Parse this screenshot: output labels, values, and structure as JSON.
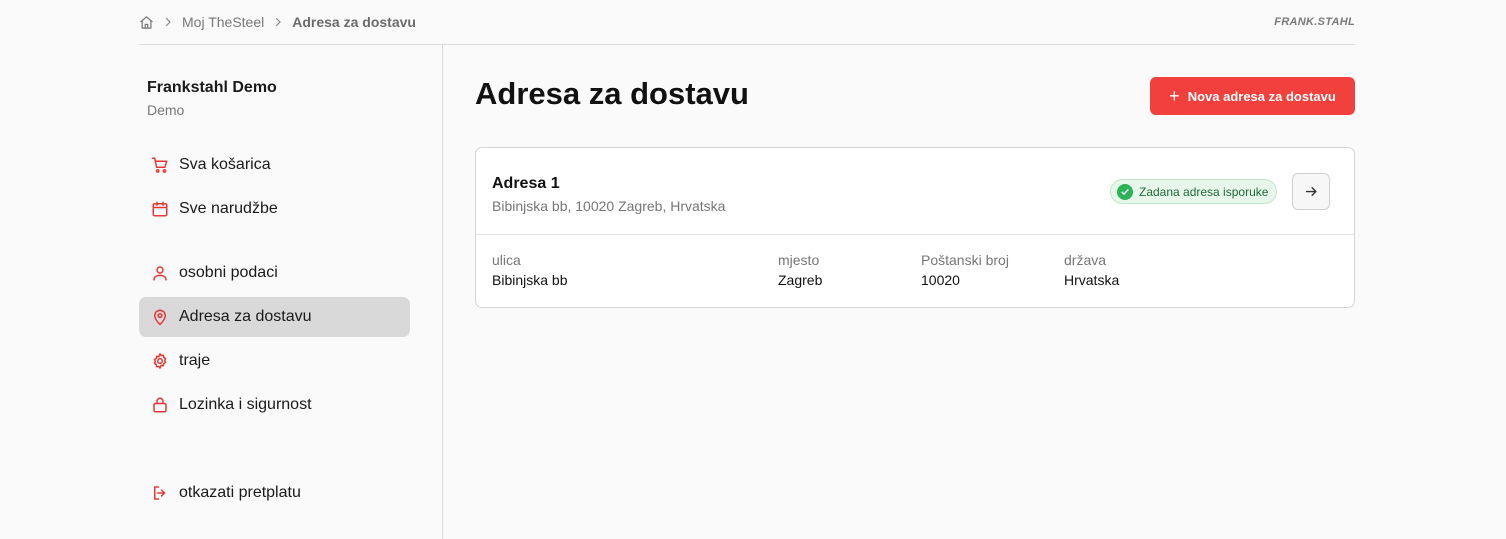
{
  "breadcrumb": {
    "home_icon": "home-icon",
    "items": [
      "Moj TheSteel",
      "Adresa za dostavu"
    ]
  },
  "logo": {
    "text": "FRANK.STAHL"
  },
  "account": {
    "name": "Frankstahl Demo",
    "subtitle": "Demo"
  },
  "sidebar": {
    "items": [
      {
        "label": "Sva košarica",
        "icon": "cart-icon"
      },
      {
        "label": "Sve narudžbe",
        "icon": "calendar-icon"
      },
      {
        "label": "osobni podaci",
        "icon": "user-icon"
      },
      {
        "label": "Adresa za dostavu",
        "icon": "location-pin-icon",
        "active": true
      },
      {
        "label": "traje",
        "icon": "gear-icon"
      },
      {
        "label": "Lozinka i sigurnost",
        "icon": "lock-icon"
      },
      {
        "label": "otkazati pretplatu",
        "icon": "logout-icon"
      }
    ]
  },
  "main": {
    "title": "Adresa za dostavu",
    "new_button": "Nova adresa za dostavu",
    "address": {
      "name": "Adresa 1",
      "summary": "Bibinjska bb, 10020 Zagreb, Hrvatska",
      "badge": "Zadana adresa isporuke",
      "fields": [
        {
          "label": "ulica",
          "value": "Bibinjska bb"
        },
        {
          "label": "mjesto",
          "value": "Zagreb"
        },
        {
          "label": "Poštanski broj",
          "value": "10020"
        },
        {
          "label": "država",
          "value": "Hrvatska"
        }
      ]
    }
  },
  "colors": {
    "accent": "#f2403c",
    "active_nav_bg": "#d9d9d9",
    "badge_bg": "#e8f7ec",
    "badge_check": "#2bb357"
  }
}
